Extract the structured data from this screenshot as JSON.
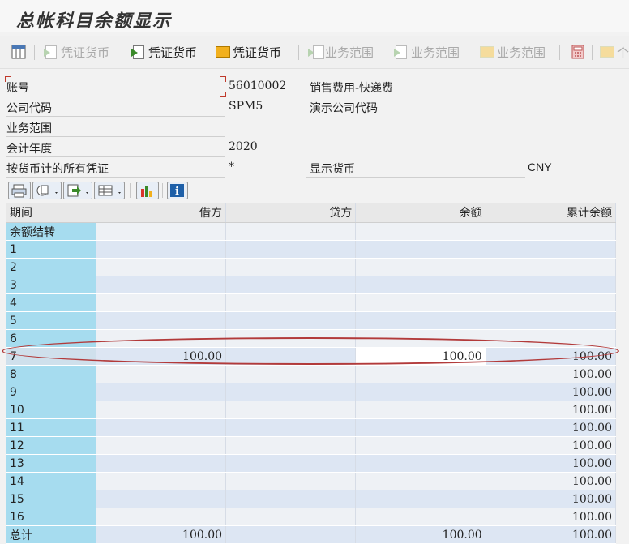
{
  "title": "总帐科目余额显示",
  "toolbar": {
    "b1": "凭证货币",
    "b2": "凭证货币",
    "b3": "凭证货币",
    "b4": "业务范围",
    "b5": "业务范围",
    "b6": "业务范围",
    "b7": "个"
  },
  "header": {
    "account_label": "账号",
    "account_value": "56010002",
    "account_desc": "销售费用-快递费",
    "company_label": "公司代码",
    "company_value": "SPM5",
    "company_desc": "演示公司代码",
    "business_area_label": "业务范围",
    "fiscal_year_label": "会计年度",
    "fiscal_year_value": "2020",
    "all_docs_label": "按货币计的所有凭证",
    "all_docs_value": "*",
    "display_currency_label": "显示货币",
    "display_currency_value": "CNY"
  },
  "grid": {
    "headers": {
      "period": "期间",
      "debit": "借方",
      "credit": "贷方",
      "balance": "余额",
      "cumulative": "累计余额"
    },
    "rows": [
      {
        "period": "余额结转",
        "debit": "",
        "credit": "",
        "balance": "",
        "cumulative": ""
      },
      {
        "period": "1",
        "debit": "",
        "credit": "",
        "balance": "",
        "cumulative": ""
      },
      {
        "period": "2",
        "debit": "",
        "credit": "",
        "balance": "",
        "cumulative": ""
      },
      {
        "period": "3",
        "debit": "",
        "credit": "",
        "balance": "",
        "cumulative": ""
      },
      {
        "period": "4",
        "debit": "",
        "credit": "",
        "balance": "",
        "cumulative": ""
      },
      {
        "period": "5",
        "debit": "",
        "credit": "",
        "balance": "",
        "cumulative": ""
      },
      {
        "period": "6",
        "debit": "",
        "credit": "",
        "balance": "",
        "cumulative": ""
      },
      {
        "period": "7",
        "debit": "100.00",
        "credit": "",
        "balance": "100.00",
        "cumulative": "100.00"
      },
      {
        "period": "8",
        "debit": "",
        "credit": "",
        "balance": "",
        "cumulative": "100.00"
      },
      {
        "period": "9",
        "debit": "",
        "credit": "",
        "balance": "",
        "cumulative": "100.00"
      },
      {
        "period": "10",
        "debit": "",
        "credit": "",
        "balance": "",
        "cumulative": "100.00"
      },
      {
        "period": "11",
        "debit": "",
        "credit": "",
        "balance": "",
        "cumulative": "100.00"
      },
      {
        "period": "12",
        "debit": "",
        "credit": "",
        "balance": "",
        "cumulative": "100.00"
      },
      {
        "period": "13",
        "debit": "",
        "credit": "",
        "balance": "",
        "cumulative": "100.00"
      },
      {
        "period": "14",
        "debit": "",
        "credit": "",
        "balance": "",
        "cumulative": "100.00"
      },
      {
        "period": "15",
        "debit": "",
        "credit": "",
        "balance": "",
        "cumulative": "100.00"
      },
      {
        "period": "16",
        "debit": "",
        "credit": "",
        "balance": "",
        "cumulative": "100.00"
      }
    ],
    "total": {
      "period": "总计",
      "debit": "100.00",
      "credit": "",
      "balance": "100.00",
      "cumulative": "100.00"
    }
  }
}
